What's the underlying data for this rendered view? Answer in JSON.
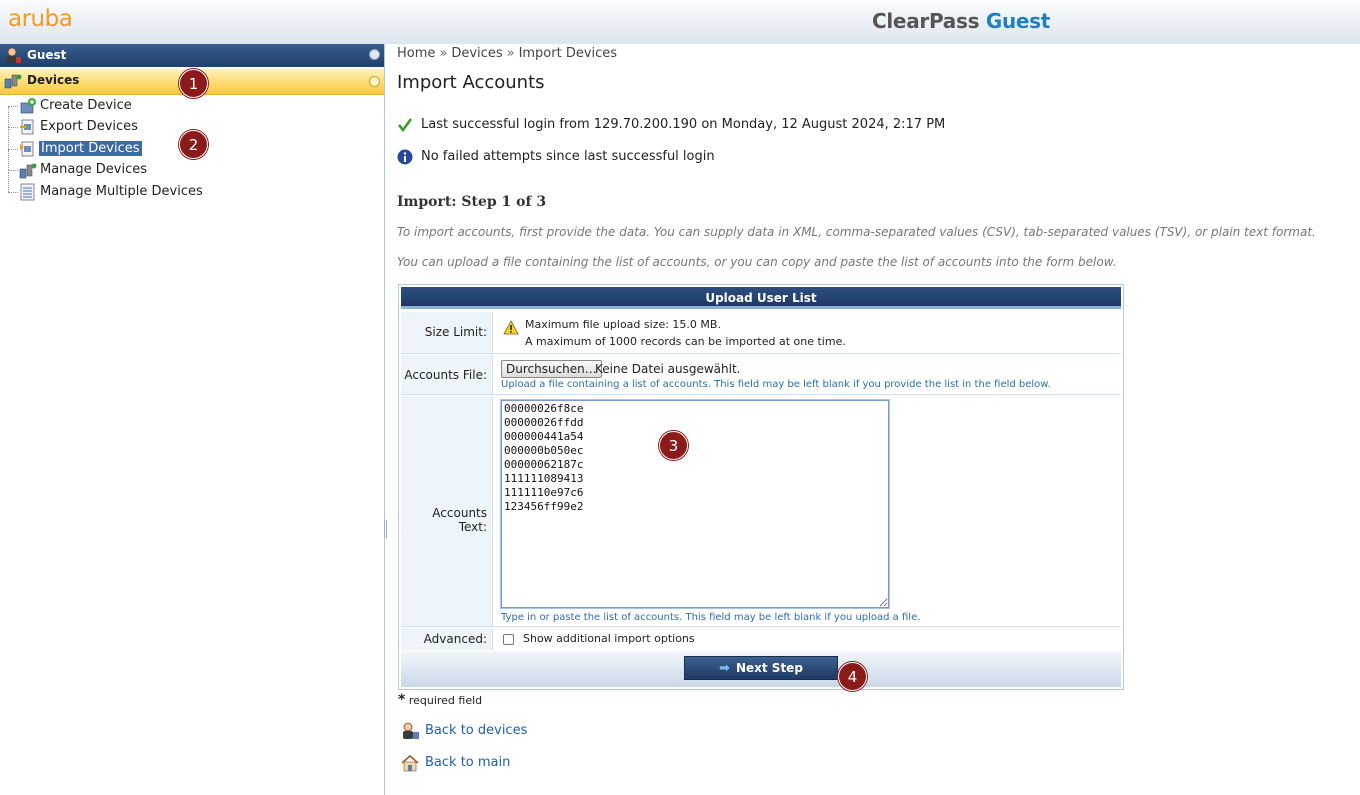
{
  "header": {
    "logo": "aruba",
    "product_part1": "ClearPass",
    "product_part2": "Guest"
  },
  "sidebar": {
    "guest_label": "Guest",
    "devices_label": "Devices",
    "items": [
      {
        "label": "Create Device",
        "icon": "create-device-icon"
      },
      {
        "label": "Export Devices",
        "icon": "export-devices-icon"
      },
      {
        "label": "Import Devices",
        "icon": "import-devices-icon",
        "selected": true
      },
      {
        "label": "Manage Devices",
        "icon": "manage-devices-icon"
      },
      {
        "label": "Manage Multiple Devices",
        "icon": "manage-multiple-devices-icon"
      }
    ]
  },
  "breadcrumb": {
    "home": "Home",
    "devices": "Devices",
    "current": "Import Devices",
    "separator": "»"
  },
  "page_title": "Import Accounts",
  "messages": {
    "login_ok": "Last successful login from 129.70.200.190 on Monday, 12 August 2024, 2:17 PM",
    "failed_info": "No failed attempts since last successful login"
  },
  "step_title": "Import: Step 1 of 3",
  "hints": {
    "hint1": "To import accounts, first provide the data. You can supply data in XML, comma-separated values (CSV), tab-separated values (TSV), or plain text format.",
    "hint2": "You can upload a file containing the list of accounts, or you can copy and paste the list of accounts into the form below."
  },
  "form": {
    "title": "Upload User List",
    "size_limit_label": "Size Limit:",
    "size_limit_line1": "Maximum file upload size: 15.0 MB.",
    "size_limit_line2": "A maximum of 1000 records can be imported at one time.",
    "accounts_file_label": "Accounts File:",
    "browse_button": "Durchsuchen…",
    "no_file": "Keine Datei ausgewählt.",
    "accounts_file_help": "Upload a file containing a list of accounts. This field may be left blank if you provide the list in the field below.",
    "accounts_text_label": "Accounts Text:",
    "accounts_text_value": "00000026f8ce\n00000026ffdd\n000000441a54\n000000b050ec\n00000062187c\n111111089413\n1111110e97c6\n123456ff99e2",
    "accounts_text_help": "Type in or paste the list of accounts. This field may be left blank if you upload a file.",
    "advanced_label": "Advanced:",
    "advanced_option": "Show additional import options",
    "next_button": "Next Step"
  },
  "required_note": "required field",
  "required_star": "*",
  "links": {
    "back_devices": "Back to devices",
    "back_main": "Back to main"
  },
  "badges": [
    "1",
    "2",
    "3",
    "4"
  ],
  "colors": {
    "accent_orange": "#f39a1f",
    "nav_blue": "#1f3f6b",
    "badge_red": "#8b1a1a",
    "link_blue": "#1f5fa8"
  }
}
